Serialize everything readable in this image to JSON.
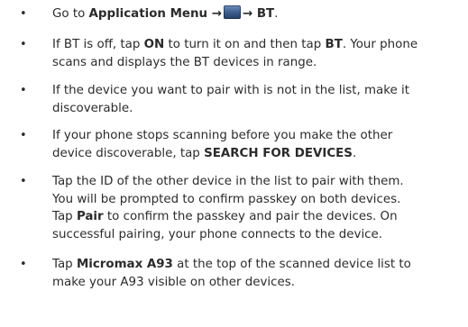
{
  "steps": [
    {
      "lines": [
        [
          {
            "t": "Go to "
          },
          {
            "t": "Application Menu →",
            "b": true
          },
          {
            "icon": "application-menu-icon"
          },
          {
            "t": "→ BT",
            "b": true
          },
          {
            "t": "."
          }
        ]
      ]
    },
    {
      "lines": [
        [
          {
            "t": "If BT is off, tap "
          },
          {
            "t": "ON",
            "b": true
          },
          {
            "t": " to turn it on and then tap "
          },
          {
            "t": "BT",
            "b": true
          },
          {
            "t": ". Your phone"
          }
        ],
        [
          {
            "t": "scans and displays the BT devices in range."
          }
        ]
      ]
    },
    {
      "lines": [
        [
          {
            "t": "If the device you want to pair with is not in the list, make it"
          }
        ],
        [
          {
            "t": "discoverable."
          }
        ]
      ]
    },
    {
      "lines": [
        [
          {
            "t": "If your phone stops scanning before you make the other"
          }
        ],
        [
          {
            "t": "device discoverable, tap "
          },
          {
            "t": "SEARCH FOR DEVICES",
            "b": true
          },
          {
            "t": "."
          }
        ]
      ]
    },
    {
      "lines": [
        [
          {
            "t": "Tap the ID of the other device in the list to pair with them."
          }
        ],
        [
          {
            "t": "You will be prompted to confirm passkey on both devices."
          }
        ],
        [
          {
            "t": "Tap "
          },
          {
            "t": "Pair",
            "b": true
          },
          {
            "t": " to confirm the passkey and pair the devices. On"
          }
        ],
        [
          {
            "t": "successful pairing, your phone connects to the device."
          }
        ]
      ]
    },
    {
      "lines": [
        [
          {
            "t": "Tap "
          },
          {
            "t": "Micromax A93",
            "b": true
          },
          {
            "t": " at the top of the scanned device list to"
          }
        ],
        [
          {
            "t": "make your A93 visible on other devices."
          }
        ]
      ]
    }
  ]
}
